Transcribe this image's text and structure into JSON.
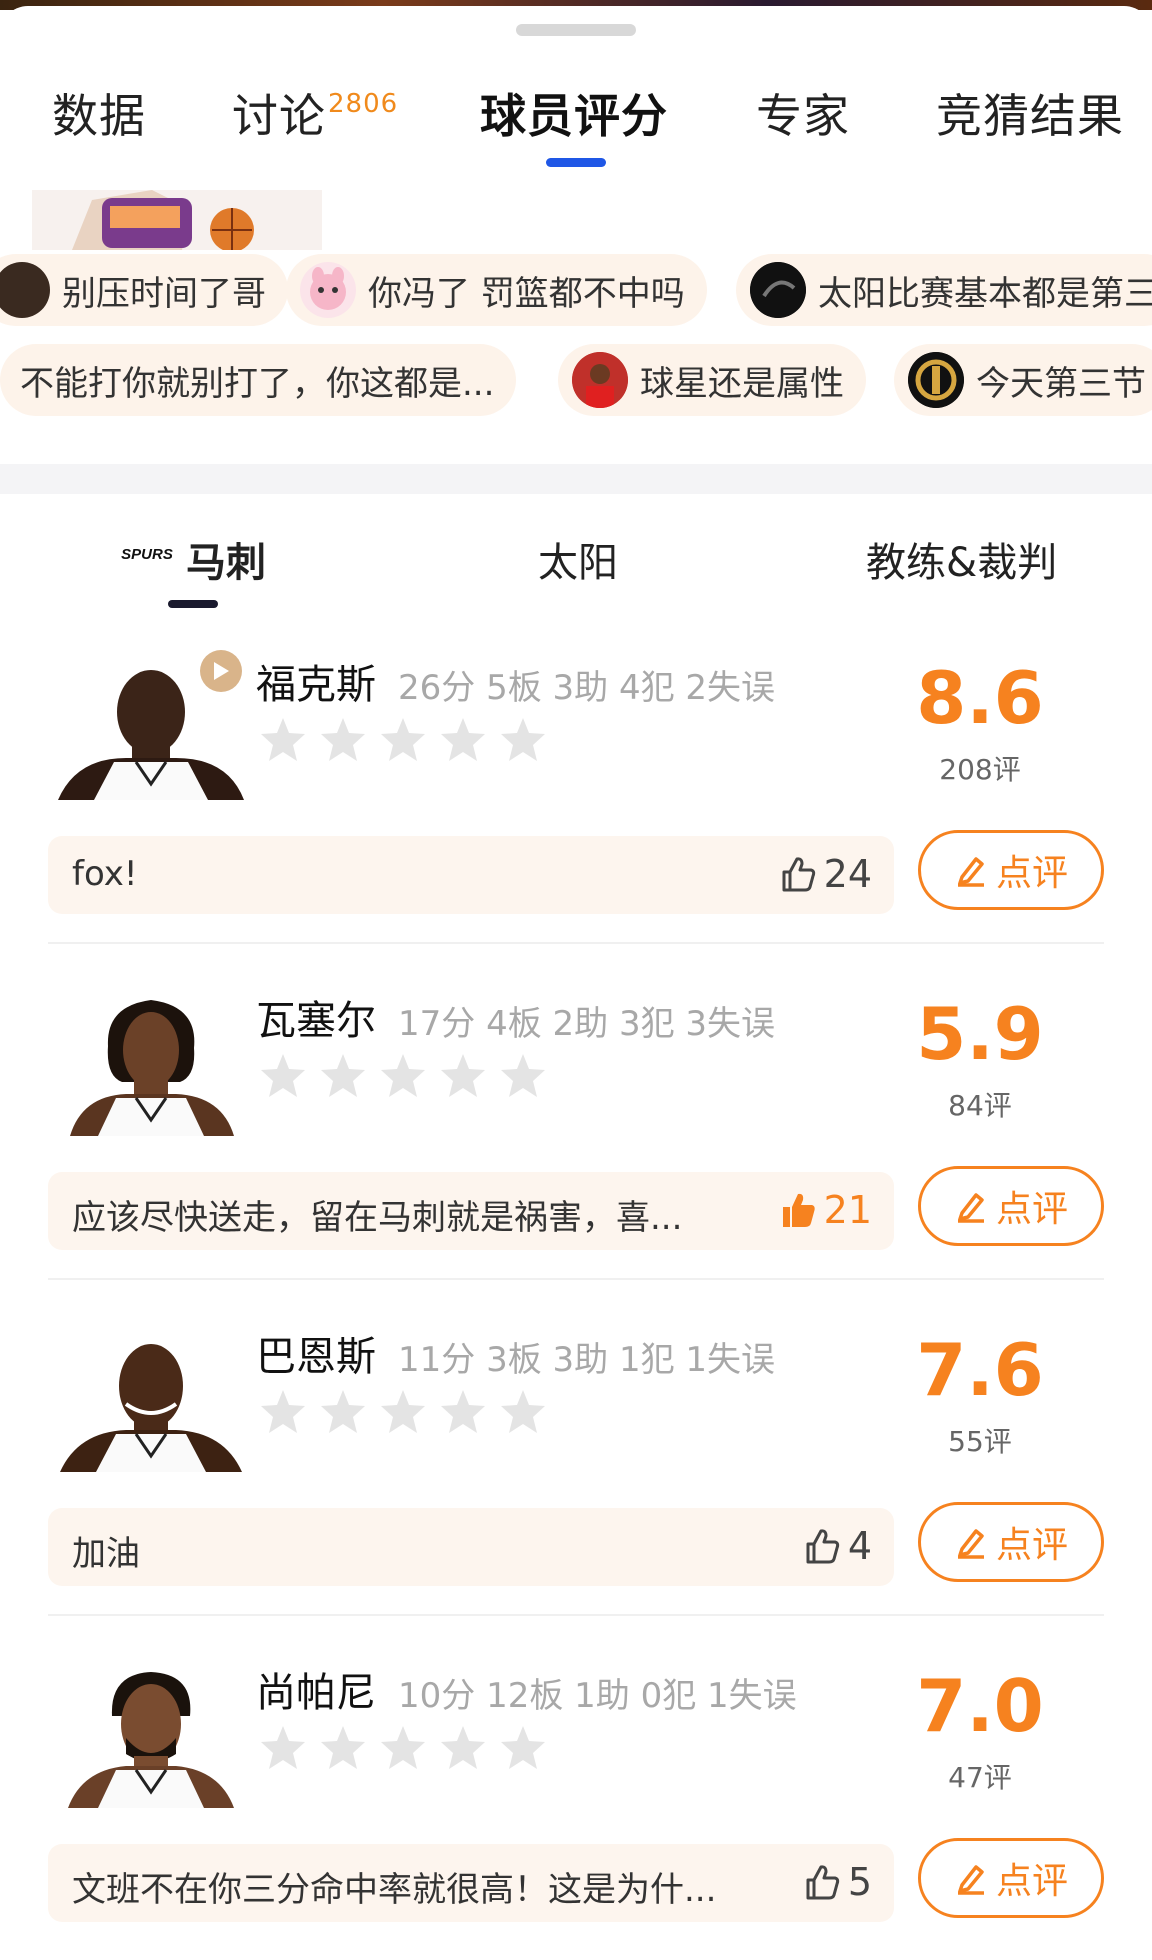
{
  "main_tabs": [
    {
      "label": "数据"
    },
    {
      "label": "讨论",
      "badge": "2806"
    },
    {
      "label": "球员评分"
    },
    {
      "label": "专家"
    },
    {
      "label": "竞猜结果"
    }
  ],
  "barrage": {
    "row1": [
      "别压时间了哥",
      "你冯了 罚篮都不中吗",
      "太阳比赛基本都是第三"
    ],
    "row2": [
      "不能打你就别打了，你这都是...",
      "球星还是属性",
      "今天第三节"
    ]
  },
  "team_tabs": [
    {
      "label": "马刺",
      "logo_text": "SPURS"
    },
    {
      "label": "太阳"
    },
    {
      "label": "教练&裁判"
    }
  ],
  "players": [
    {
      "name": "福克斯",
      "stats": "26分 5板 3助 4犯 2失误",
      "score": "8.6",
      "count": "208评",
      "comment": "fox!",
      "likes": "24",
      "liked": false,
      "has_video": true
    },
    {
      "name": "瓦塞尔",
      "stats": "17分 4板 2助 3犯 3失误",
      "score": "5.9",
      "count": "84评",
      "comment": "应该尽快送走，留在马刺就是祸害，喜...",
      "likes": "21",
      "liked": true,
      "has_video": false
    },
    {
      "name": "巴恩斯",
      "stats": "11分 3板 3助 1犯 1失误",
      "score": "7.6",
      "count": "55评",
      "comment": "加油",
      "likes": "4",
      "liked": false,
      "has_video": false
    },
    {
      "name": "尚帕尼",
      "stats": "10分 12板 1助 0犯 1失误",
      "score": "7.0",
      "count": "47评",
      "comment": "文班不在你三分命中率就很高！这是为什...",
      "likes": "5",
      "liked": false,
      "has_video": false
    }
  ],
  "review_button_label": "点评",
  "colors": {
    "accent": "#f6821f",
    "tab_indicator": "#1f57e6",
    "stat_gray": "#a8a8a8"
  }
}
